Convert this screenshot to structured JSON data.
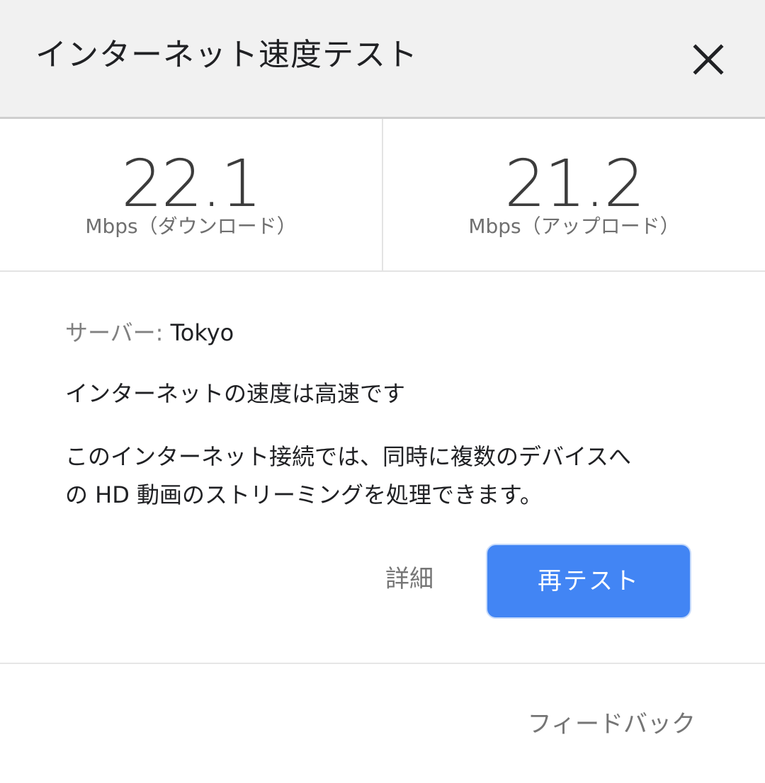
{
  "header": {
    "title": "インターネット速度テスト",
    "close_icon": "close-icon"
  },
  "download": {
    "value": "22.1",
    "unit_label": "Mbps（ダウンロード）"
  },
  "upload": {
    "value": "21.2",
    "unit_label": "Mbps（アップロード）"
  },
  "server": {
    "label": "サーバー: ",
    "value": "Tokyo"
  },
  "status": {
    "text": "インターネットの速度は高速です"
  },
  "description": {
    "line1": "このインターネット接続では、同時に複数のデバイスへ",
    "line2": "の HD 動画のストリーミングを処理できます。"
  },
  "actions": {
    "details_label": "詳細",
    "retest_label": "再テスト"
  },
  "footer": {
    "feedback_label": "フィードバック"
  },
  "colors": {
    "accent": "#4285f4",
    "header_bg": "#f1f1f1"
  }
}
